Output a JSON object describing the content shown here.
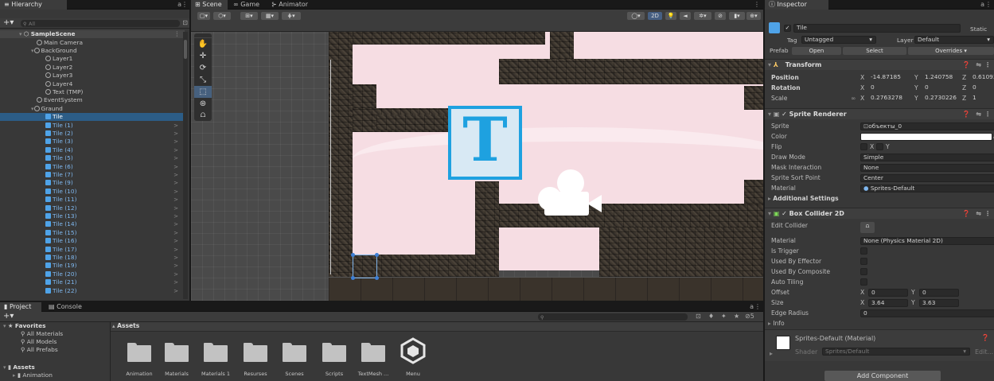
{
  "hierarchy": {
    "tab_label": "Hierarchy",
    "search_placeholder": "All",
    "scene_name": "SampleScene",
    "items": [
      {
        "label": "Main Camera"
      },
      {
        "label": "BackGround"
      },
      {
        "label": "Layer1"
      },
      {
        "label": "Layer2"
      },
      {
        "label": "Layer3"
      },
      {
        "label": "Layer4"
      },
      {
        "label": "Text (TMP)"
      },
      {
        "label": "EventSystem"
      },
      {
        "label": "Graund"
      },
      {
        "label": "Tile"
      },
      {
        "label": "Tile (1)"
      },
      {
        "label": "Tile (2)"
      },
      {
        "label": "Tile (3)"
      },
      {
        "label": "Tile (4)"
      },
      {
        "label": "Tile (5)"
      },
      {
        "label": "Tile (6)"
      },
      {
        "label": "Tile (7)"
      },
      {
        "label": "Tile (9)"
      },
      {
        "label": "Tile (10)"
      },
      {
        "label": "Tile (11)"
      },
      {
        "label": "Tile (12)"
      },
      {
        "label": "Tile (13)"
      },
      {
        "label": "Tile (14)"
      },
      {
        "label": "Tile (15)"
      },
      {
        "label": "Tile (16)"
      },
      {
        "label": "Tile (17)"
      },
      {
        "label": "Tile (18)"
      },
      {
        "label": "Tile (19)"
      },
      {
        "label": "Tile (20)"
      },
      {
        "label": "Tile (21)"
      },
      {
        "label": "Tile (22)"
      }
    ]
  },
  "scene_tabs": [
    {
      "label": "Scene"
    },
    {
      "label": "Game"
    },
    {
      "label": "Animator"
    }
  ],
  "scene_toolbar": {
    "mode_2d": "2D"
  },
  "inspector": {
    "tab_label": "Inspector",
    "object_name": "Tile",
    "static_label": "Static",
    "tag_label": "Tag",
    "tag_value": "Untagged",
    "layer_label": "Layer",
    "layer_value": "Default",
    "prefab_label": "Prefab",
    "prefab_open": "Open",
    "prefab_select": "Select",
    "prefab_overrides": "Overrides",
    "transform": {
      "title": "Transform",
      "position_label": "Position",
      "position": {
        "x": "-14.87185",
        "y": "1.240758",
        "z": "0.6109309"
      },
      "rotation_label": "Rotation",
      "rotation": {
        "x": "0",
        "y": "0",
        "z": "0"
      },
      "scale_label": "Scale",
      "scale": {
        "x": "0.2763278",
        "y": "0.2730226",
        "z": "1"
      }
    },
    "sprite_renderer": {
      "title": "Sprite Renderer",
      "sprite_label": "Sprite",
      "sprite_value": "объекты_0",
      "color_label": "Color",
      "flip_label": "Flip",
      "flip_x": "X",
      "flip_y": "Y",
      "draw_mode_label": "Draw Mode",
      "draw_mode_value": "Simple",
      "mask_label": "Mask Interaction",
      "mask_value": "None",
      "sort_point_label": "Sprite Sort Point",
      "sort_point_value": "Center",
      "material_label": "Material",
      "material_value": "Sprites-Default",
      "additional": "Additional Settings"
    },
    "box_collider": {
      "title": "Box Collider 2D",
      "edit_collider_label": "Edit Collider",
      "material_label": "Material",
      "material_value": "None (Physics Material 2D)",
      "is_trigger_label": "Is Trigger",
      "used_by_effector_label": "Used By Effector",
      "used_by_composite_label": "Used By Composite",
      "auto_tiling_label": "Auto Tiling",
      "offset_label": "Offset",
      "offset": {
        "x": "0",
        "y": "0"
      },
      "size_label": "Size",
      "size": {
        "x": "3.64",
        "y": "3.63"
      },
      "edge_radius_label": "Edge Radius",
      "edge_radius_value": "0",
      "info_label": "Info"
    },
    "material_section": {
      "title": "Sprites-Default (Material)",
      "shader_label": "Shader",
      "shader_value": "Sprites/Default",
      "edit_label": "Edit..."
    },
    "add_component": "Add Component"
  },
  "project": {
    "tab_project": "Project",
    "tab_console": "Console",
    "favorites_label": "Favorites",
    "favorites": [
      {
        "label": "All Materials"
      },
      {
        "label": "All Models"
      },
      {
        "label": "All Prefabs"
      }
    ],
    "assets_label": "Assets",
    "tree_items": [
      {
        "label": "Animation"
      }
    ],
    "breadcrumb": "Assets",
    "hidden_count": "5",
    "folders": [
      {
        "label": "Animation"
      },
      {
        "label": "Materials"
      },
      {
        "label": "Materials 1"
      },
      {
        "label": "Resurses"
      },
      {
        "label": "Scenes"
      },
      {
        "label": "Scripts"
      },
      {
        "label": "TextMesh ..."
      },
      {
        "label": "Menu"
      }
    ]
  },
  "colors": {
    "accent_blue": "#4fa3e8",
    "selection": "#2c5d87",
    "background_pink": "#f6dde3",
    "text_icon_blue": "#1ea1e0"
  }
}
